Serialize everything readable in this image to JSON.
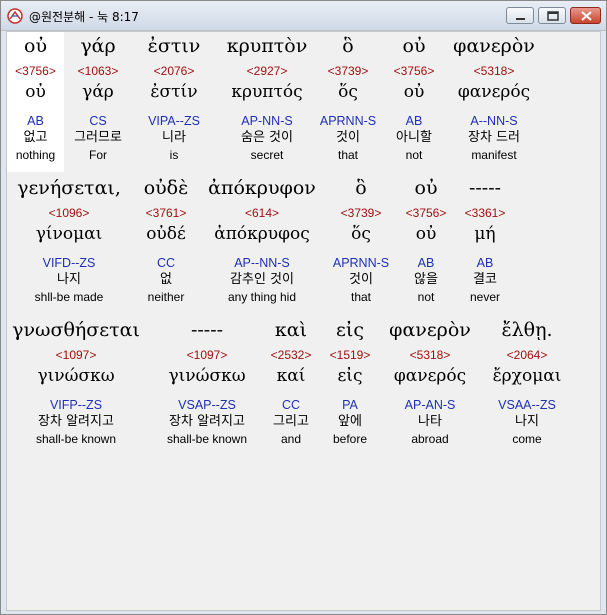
{
  "window": {
    "title": "@원전분해 - 눅 8:17"
  },
  "rows": [
    {
      "words": [
        {
          "greek": "οὐ",
          "strong": "<3756>",
          "lemma": "οὐ",
          "parse": "AB",
          "korean": "없고",
          "english": "nothing",
          "highlight": true
        },
        {
          "greek": "γάρ",
          "strong": "<1063>",
          "lemma": "γάρ",
          "parse": "CS",
          "korean": "그러므로",
          "english": "For"
        },
        {
          "greek": "ἐστιν",
          "strong": "<2076>",
          "lemma": "ἐστίν",
          "parse": "VIPA--ZS",
          "korean": "니라",
          "english": "is"
        },
        {
          "greek": "κρυπτὸν",
          "strong": "<2927>",
          "lemma": "κρυπτός",
          "parse": "AP-NN-S",
          "korean": "숨은 것이",
          "english": "secret"
        },
        {
          "greek": "ὃ",
          "strong": "<3739>",
          "lemma": "ὅς",
          "parse": "APRNN-S",
          "korean": "것이",
          "english": "that"
        },
        {
          "greek": "οὐ",
          "strong": "<3756>",
          "lemma": "οὐ",
          "parse": "AB",
          "korean": "아니할",
          "english": "not"
        },
        {
          "greek": "φανερὸν",
          "strong": "<5318>",
          "lemma": "φανερός",
          "parse": "A--NN-S",
          "korean": "장차 드러",
          "english": "manifest"
        }
      ]
    },
    {
      "words": [
        {
          "greek": "γενήσεται,",
          "strong": "<1096>",
          "lemma": "γίνομαι",
          "parse": "VIFD--ZS",
          "korean": "나지",
          "english": "shll-be made"
        },
        {
          "greek": "οὐδὲ",
          "strong": "<3761>",
          "lemma": "οὐδέ",
          "parse": "CC",
          "korean": "없",
          "english": "neither"
        },
        {
          "greek": "ἀπόκρυφον",
          "strong": "<614>",
          "lemma": "ἀπόκρυφος",
          "parse": "AP--NN-S",
          "korean": "감추인 것이",
          "english": "any thing hid"
        },
        {
          "greek": "ὃ",
          "strong": "<3739>",
          "lemma": "ὅς",
          "parse": "APRNN-S",
          "korean": "것이",
          "english": "that"
        },
        {
          "greek": "οὐ",
          "strong": "<3756>",
          "lemma": "οὐ",
          "parse": "AB",
          "korean": "않을",
          "english": "not"
        },
        {
          "greek": "-----",
          "strong": "<3361>",
          "lemma": "μή",
          "parse": "AB",
          "korean": "결코",
          "english": "never"
        }
      ]
    },
    {
      "words": [
        {
          "greek": "γνωσθήσεται",
          "strong": "<1097>",
          "lemma": "γινώσκω",
          "parse": "VIFP--ZS",
          "korean": "장차 알려지고",
          "english": "shall-be known"
        },
        {
          "greek": "-----",
          "strong": "<1097>",
          "lemma": "γινώσκω",
          "parse": "VSAP--ZS",
          "korean": "장차 알려지고",
          "english": "shall-be known"
        },
        {
          "greek": "καὶ",
          "strong": "<2532>",
          "lemma": "καί",
          "parse": "CC",
          "korean": "그리고",
          "english": "and"
        },
        {
          "greek": "εἰς",
          "strong": "<1519>",
          "lemma": "εἰς",
          "parse": "PA",
          "korean": "앞에",
          "english": "before"
        },
        {
          "greek": "φανερὸν",
          "strong": "<5318>",
          "lemma": "φανερός",
          "parse": "AP-AN-S",
          "korean": "나타",
          "english": "abroad"
        },
        {
          "greek": "ἔλθῃ.",
          "strong": "<2064>",
          "lemma": "ἔρχομαι",
          "parse": "VSAA--ZS",
          "korean": "나지",
          "english": "come"
        }
      ]
    }
  ]
}
